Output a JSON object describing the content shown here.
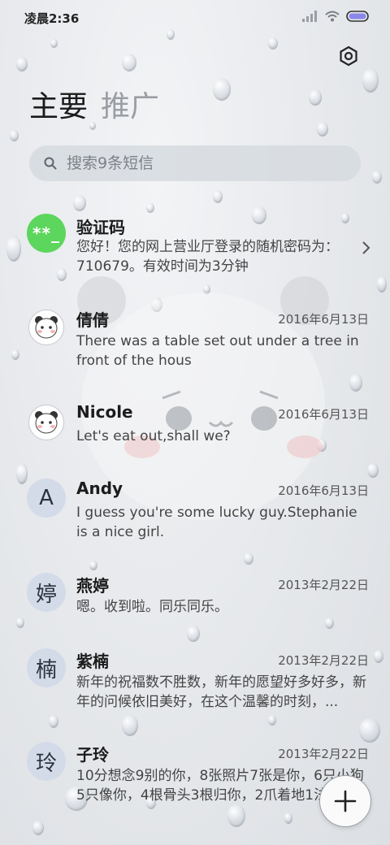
{
  "status_bar": {
    "time": "凌晨2:36"
  },
  "tabs": [
    {
      "label": "主要",
      "active": true
    },
    {
      "label": "推广",
      "active": false
    }
  ],
  "search": {
    "placeholder": "搜索9条短信"
  },
  "messages": [
    {
      "sender": "验证码",
      "avatar_text": "**_",
      "date": "",
      "preview": "您好！您的网上营业厅登录的随机密码为：710679。有效时间为3分钟"
    },
    {
      "sender": "倩倩",
      "avatar_text": "",
      "date": "2016年6月13日",
      "preview": "There was a table set out under a tree in front of the hous"
    },
    {
      "sender": "Nicole",
      "avatar_text": "",
      "date": "2016年6月13日",
      "preview": "Let's eat out,shall we?"
    },
    {
      "sender": "Andy",
      "avatar_text": "A",
      "date": "2016年6月13日",
      "preview": "I guess you're some lucky guy.Stephanie is a nice girl."
    },
    {
      "sender": "燕婷",
      "avatar_text": "婷",
      "date": "2013年2月22日",
      "preview": "嗯。收到啦。同乐同乐。"
    },
    {
      "sender": "紫楠",
      "avatar_text": "楠",
      "date": "2013年2月22日",
      "preview": "新年的祝福数不胜数，新年的愿望好多好多，新年的问候依旧美好，在这个温馨的时刻，..."
    },
    {
      "sender": "子玲",
      "avatar_text": "玲",
      "date": "2013年2月22日",
      "preview": "10分想念9别的你，8张照片7张是你，6只小狗5只像你，4根骨头3根归你，2爪着地1法..."
    }
  ],
  "colors": {
    "verification_avatar": "#5cd65c",
    "letter_avatar": "#d3dbe9",
    "tab_inactive": "#9a9ea4"
  },
  "icons": [
    "settings-icon",
    "search-icon",
    "chevron-right-icon",
    "add-icon",
    "signal-icon",
    "wifi-icon",
    "battery-icon"
  ]
}
